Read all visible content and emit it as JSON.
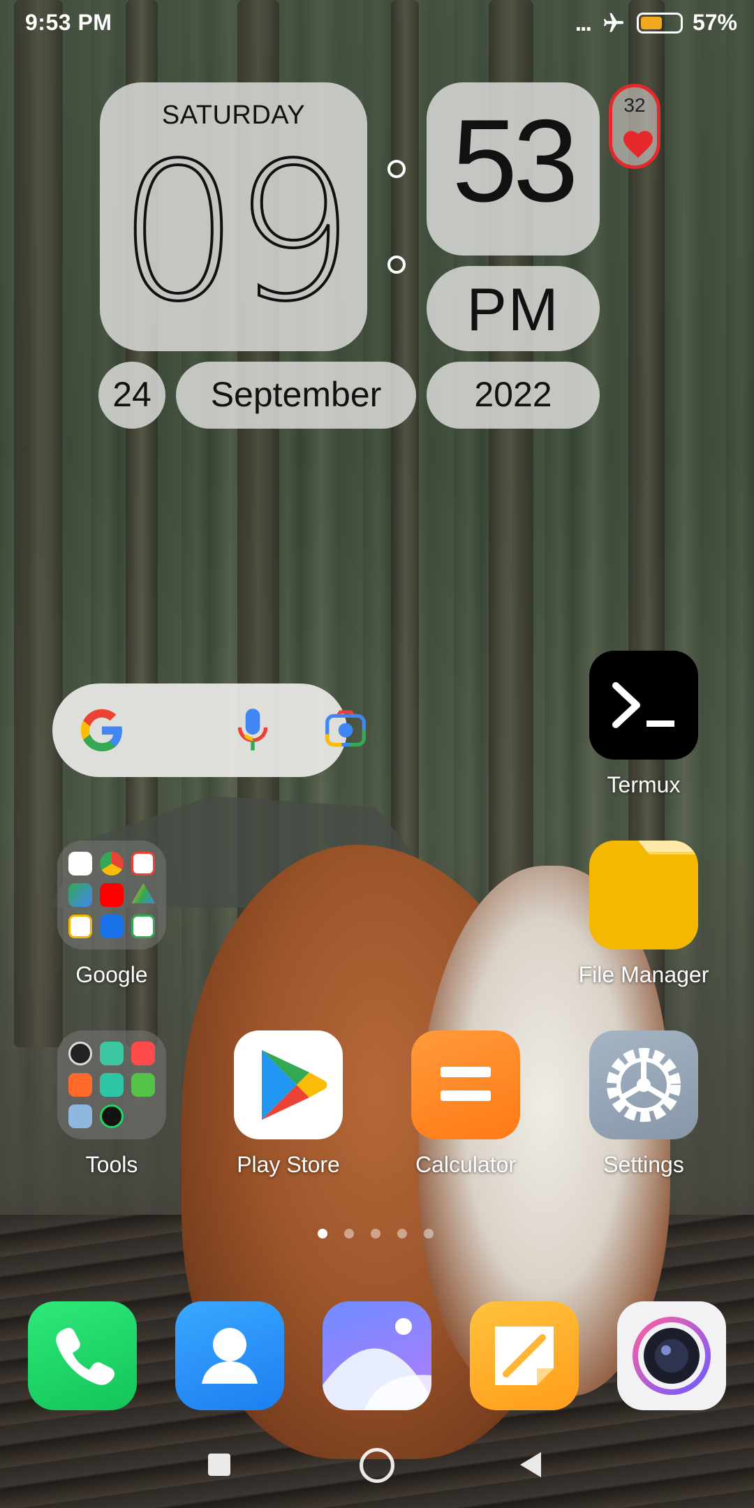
{
  "status_bar": {
    "time": "9:53 PM",
    "more_indicator": "...",
    "airplane_icon": "airplane-icon",
    "battery_icon": "battery-icon",
    "battery_percent": "57%",
    "battery_level": 0.57
  },
  "clock_widget": {
    "weekday": "SATURDAY",
    "hour": "09",
    "minute": "53",
    "ampm": "PM",
    "day": "24",
    "month": "September",
    "year": "2022",
    "heart_count": "32",
    "heart_icon": "heart-icon"
  },
  "search_widget": {
    "icons": [
      "google-g-icon",
      "microphone-icon",
      "google-lens-icon"
    ]
  },
  "apps": {
    "termux": {
      "label": "Termux",
      "icon": "terminal-icon"
    },
    "google_folder": {
      "label": "Google",
      "icon": "folder-icon"
    },
    "file_manager": {
      "label": "File Manager",
      "icon": "folder-icon"
    },
    "tools_folder": {
      "label": "Tools",
      "icon": "folder-icon"
    },
    "play_store": {
      "label": "Play Store",
      "icon": "play-store-icon"
    },
    "calculator": {
      "label": "Calculator",
      "icon": "calculator-icon"
    },
    "settings": {
      "label": "Settings",
      "icon": "gear-icon"
    }
  },
  "page_indicator": {
    "pages": 5,
    "current": 1
  },
  "dock": [
    {
      "name": "phone",
      "icon": "phone-icon"
    },
    {
      "name": "contacts",
      "icon": "contacts-icon"
    },
    {
      "name": "gallery",
      "icon": "gallery-icon"
    },
    {
      "name": "notes",
      "icon": "notes-icon"
    },
    {
      "name": "camera",
      "icon": "camera-icon"
    }
  ],
  "nav_bar": {
    "buttons": [
      "recents-icon",
      "home-icon",
      "back-icon"
    ]
  },
  "colors": {
    "battery_fill": "#f4a81e",
    "heart": "#e5282b",
    "termux_bg": "#000000",
    "file_manager_bg": "#f5b800",
    "calculator_bg": "#ff8a20",
    "settings_bg": "#95a5b6",
    "phone_bg": "#1fd66a",
    "contacts_bg": "#2a92f8"
  }
}
